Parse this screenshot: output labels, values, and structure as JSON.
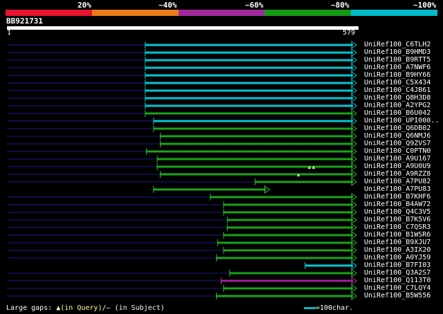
{
  "legend": {
    "labels": [
      "20%",
      "~40%",
      "~60%",
      "~80%",
      "~100%"
    ],
    "colors": [
      "#e8132f",
      "#ec7b1b",
      "#a3299f",
      "#179a13",
      "#00bbc9"
    ]
  },
  "query": {
    "id": "BB921731",
    "start_label": "1",
    "end_label": "579",
    "length": 579
  },
  "hits": [
    {
      "name": "UniRef100_C6TLH2",
      "start": 230,
      "end": 579,
      "color": "cyan",
      "dash": true
    },
    {
      "name": "UniRef100_B9HMD3",
      "start": 230,
      "end": 579,
      "color": "cyan",
      "dash": true
    },
    {
      "name": "UniRef100_B9RTT5",
      "start": 230,
      "end": 579,
      "color": "cyan",
      "dash": true
    },
    {
      "name": "UniRef100_A7NWF6",
      "start": 230,
      "end": 579,
      "color": "cyan",
      "dash": true
    },
    {
      "name": "UniRef100_B9HY66",
      "start": 230,
      "end": 579,
      "color": "cyan",
      "dash": true
    },
    {
      "name": "UniRef100_C5X434",
      "start": 230,
      "end": 579,
      "color": "cyan",
      "dash": true
    },
    {
      "name": "UniRef100_C4JB61",
      "start": 230,
      "end": 579,
      "color": "cyan",
      "dash": true
    },
    {
      "name": "UniRef100_Q8H3D8",
      "start": 230,
      "end": 579,
      "color": "cyan",
      "dash": true
    },
    {
      "name": "UniRef100_A2YPG2",
      "start": 230,
      "end": 579,
      "color": "cyan",
      "dash": true
    },
    {
      "name": "UniRef100_B6U042",
      "start": 230,
      "end": 579,
      "color": "green",
      "dash": true
    },
    {
      "name": "UniRef100_UPI000..",
      "start": 244,
      "end": 579,
      "color": "cyan",
      "dash": true
    },
    {
      "name": "UniRef100_Q6DB02",
      "start": 244,
      "end": 579,
      "color": "green",
      "dash": true
    },
    {
      "name": "UniRef100_Q6NMJ6",
      "start": 255,
      "end": 579,
      "color": "green",
      "dash": true
    },
    {
      "name": "UniRef100_Q9ZVS7",
      "start": 255,
      "end": 579,
      "color": "green",
      "dash": true
    },
    {
      "name": "UniRef100_C0PTN0",
      "start": 232,
      "end": 579,
      "color": "green",
      "dash": true
    },
    {
      "name": "UniRef100_A9U167",
      "start": 250,
      "end": 579,
      "color": "green",
      "dash": true
    },
    {
      "name": "UniRef100_A9U0U9",
      "start": 250,
      "end": 579,
      "color": "green",
      "dash": true
    },
    {
      "name": "UniRef100_A9RZZ8",
      "start": 255,
      "end": 579,
      "color": "green",
      "dash": true
    },
    {
      "name": "UniRef100_A7PU82",
      "start": 412,
      "end": 579,
      "color": "green",
      "dash": true
    },
    {
      "name": "UniRef100_A7PU83",
      "start": 244,
      "end": 435,
      "color": "green",
      "dash": false
    },
    {
      "name": "UniRef100_B7KHF6",
      "start": 338,
      "end": 579,
      "color": "green",
      "dash": true
    },
    {
      "name": "UniRef100_B4AW72",
      "start": 360,
      "end": 579,
      "color": "green",
      "dash": true
    },
    {
      "name": "UniRef100_Q4C3V5",
      "start": 360,
      "end": 579,
      "color": "green",
      "dash": true
    },
    {
      "name": "UniRef100_B7K5V6",
      "start": 366,
      "end": 579,
      "color": "green",
      "dash": true
    },
    {
      "name": "UniRef100_C7QSR3",
      "start": 366,
      "end": 579,
      "color": "green",
      "dash": true
    },
    {
      "name": "UniRef100_B1WSR6",
      "start": 360,
      "end": 579,
      "color": "green",
      "dash": true
    },
    {
      "name": "UniRef100_B9XJU7",
      "start": 350,
      "end": 579,
      "color": "green",
      "dash": true
    },
    {
      "name": "UniRef100_A3IX20",
      "start": 360,
      "end": 579,
      "color": "green",
      "dash": true
    },
    {
      "name": "UniRef100_A0YJ59",
      "start": 348,
      "end": 579,
      "color": "green",
      "dash": true
    },
    {
      "name": "UniRef100_B7FI03",
      "start": 495,
      "end": 579,
      "color": "cyan",
      "dash": false
    },
    {
      "name": "UniRef100_Q3A2S7",
      "start": 370,
      "end": 579,
      "color": "green",
      "dash": true
    },
    {
      "name": "UniRef100_Q113T0",
      "start": 356,
      "end": 579,
      "color": "purple",
      "dash": true
    },
    {
      "name": "UniRef100_C7LQY4",
      "start": 360,
      "end": 579,
      "color": "green",
      "dash": true
    },
    {
      "name": "UniRef100_B5W556",
      "start": 348,
      "end": 579,
      "color": "green",
      "dash": true
    }
  ],
  "gap_markers": [
    {
      "row": 16,
      "pos": 502
    },
    {
      "row": 16,
      "pos": 509
    },
    {
      "row": 17,
      "pos": 484
    }
  ],
  "footer": {
    "gaps_prefix": "Large gaps: ",
    "gaps_query": "▲(in Query)",
    "gaps_subject": "/— (in Subject)",
    "scale_text": "=100char."
  }
}
